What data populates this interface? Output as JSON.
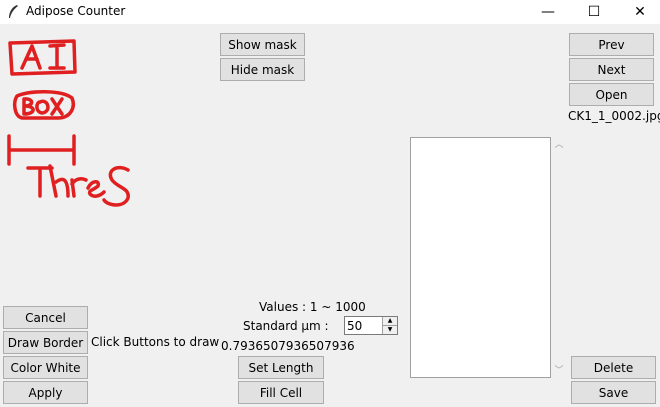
{
  "window": {
    "title": "Adipose Counter",
    "minimize": "—",
    "maximize": "☐",
    "close": "✕"
  },
  "toolbar": {
    "show_mask": "Show mask",
    "hide_mask": "Hide mask"
  },
  "nav": {
    "prev": "Prev",
    "next": "Next",
    "open": "Open",
    "filename": "CK1_1_0002.jpg"
  },
  "left_panel": {
    "cancel": "Cancel",
    "draw_border": "Draw Border",
    "hint": "Click Buttons to draw",
    "color_white": "Color White",
    "apply": "Apply"
  },
  "length": {
    "values_range": "Values : 1 ~ 1000",
    "standard_label": "Standard µm :",
    "standard_value": "50",
    "ratio": "0.7936507936507936",
    "set_length": "Set Length",
    "fill_cell": "Fill Cell"
  },
  "right_panel": {
    "delete": "Delete",
    "save": "Save"
  },
  "annotations": {
    "ai": "AI",
    "box": "BOX",
    "thres": "Thres",
    "color": "#e02020"
  }
}
